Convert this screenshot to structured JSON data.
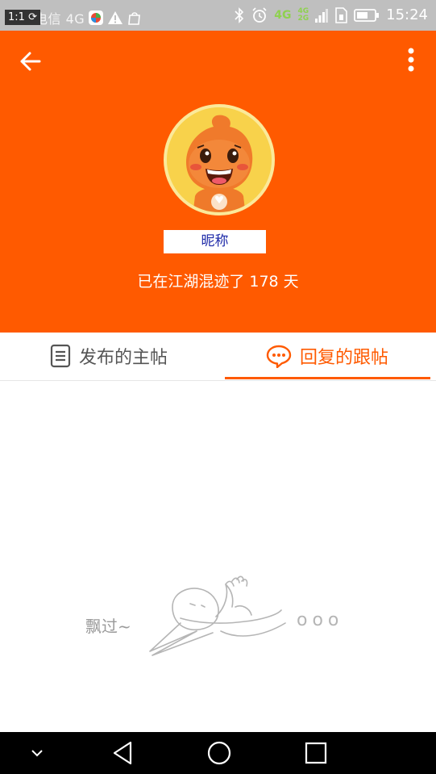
{
  "status_bar": {
    "indicator": "1:1",
    "carrier": "中国电信 4G",
    "time": "15:24",
    "network_labels": [
      "4G",
      "4G",
      "2G"
    ],
    "icons": [
      "rotate-icon",
      "app-icon",
      "warning-icon",
      "bag-icon",
      "bluetooth-icon",
      "alarm-icon",
      "signal-icon",
      "sim-icon",
      "battery-icon"
    ]
  },
  "header": {
    "back_icon": "arrow-left-icon",
    "more_icon": "more-vertical-icon",
    "avatar_icon": "mascot-avatar",
    "nickname": "昵称",
    "days_text": "已在江湖混迹了 178 天"
  },
  "tabs": {
    "posts_label": "发布的主帖",
    "replies_label": "回复的跟帖",
    "active": "replies"
  },
  "empty_state": {
    "caption": "飘过~",
    "dots": "ooo"
  },
  "nav_bar": {
    "icons": [
      "chevron-down-icon",
      "back-triangle-icon",
      "home-circle-icon",
      "recents-square-icon"
    ]
  },
  "colors": {
    "accent": "#ff5a00",
    "status_bar": "#bfbfbf",
    "tab_inactive": "#555555",
    "nickname_text": "#1e2aa8"
  }
}
